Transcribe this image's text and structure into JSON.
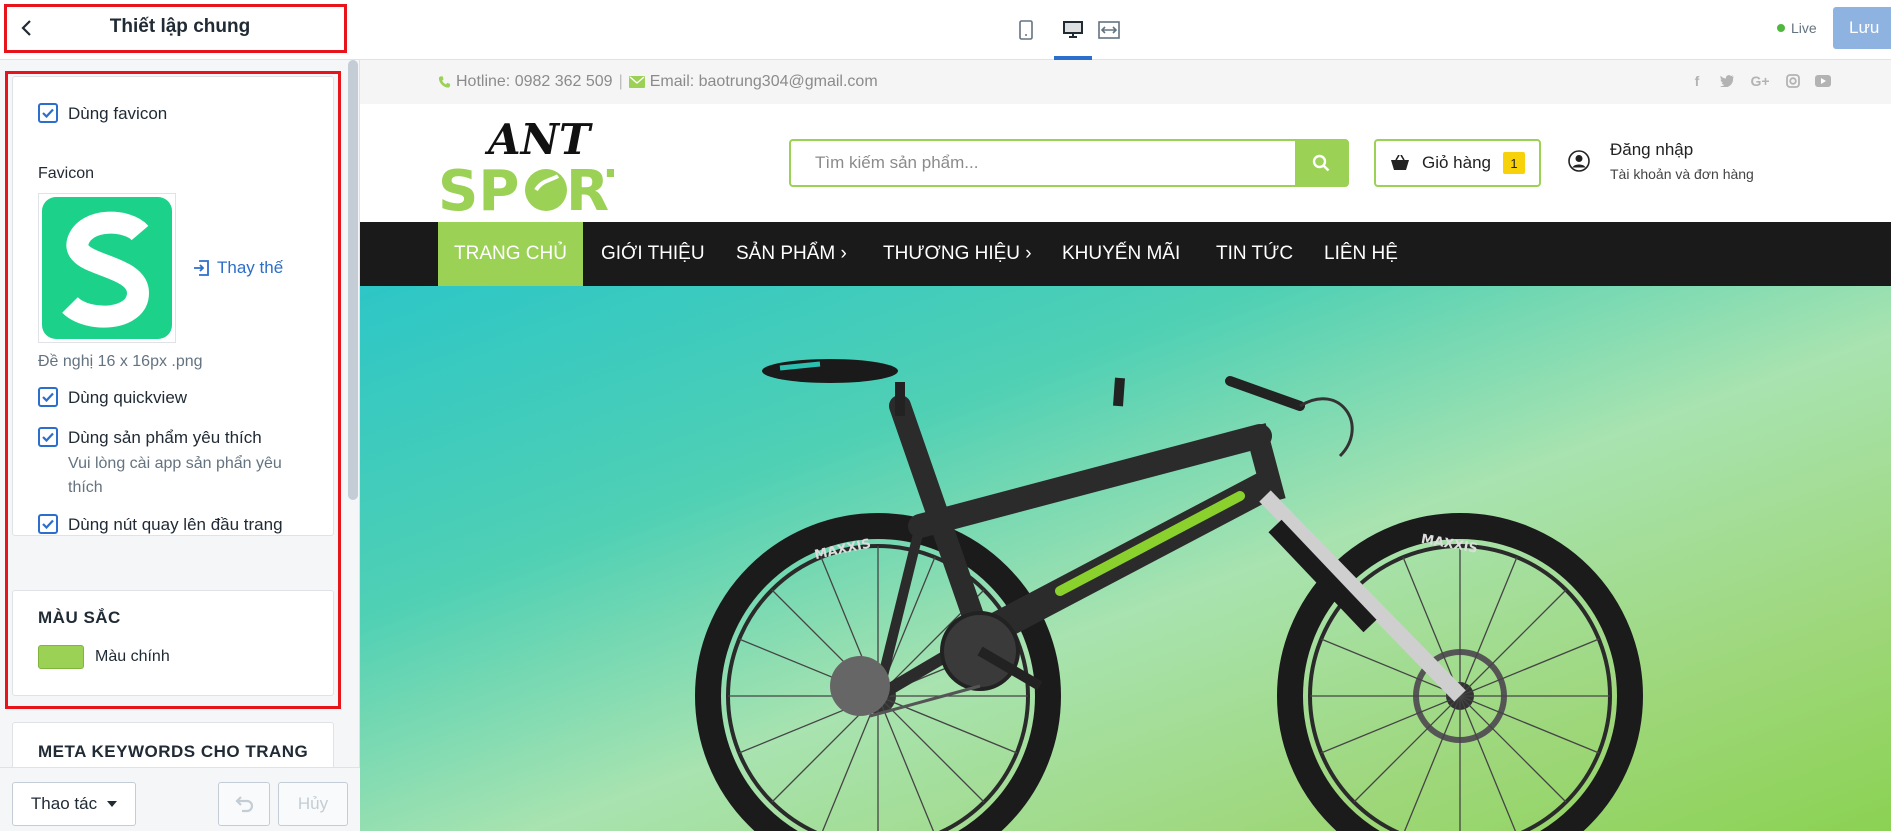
{
  "sidebar": {
    "title": "Thiết lập chung",
    "options": {
      "use_favicon": "Dùng favicon",
      "favicon_label": "Favicon",
      "replace_label": "Thay thế",
      "favicon_hint": "Đề nghị 16 x 16px .png",
      "use_quickview": "Dùng quickview",
      "use_wishlist": "Dùng sản phẩm yêu thích",
      "wishlist_note": "Vui lòng cài app sản phẩn yêu thích",
      "use_back_to_top": "Dùng nút quay lên đầu trang"
    },
    "colors": {
      "section_title": "MÀU SẮC",
      "primary_color_label": "Màu chính",
      "primary_color": "#9bd155"
    },
    "meta": {
      "section_title": "META KEYWORDS CHO TRANG CHỦ(SEO)"
    },
    "footer": {
      "actions_label": "Thao tác",
      "cancel_label": "Hủy"
    }
  },
  "topbar": {
    "live_label": "Live",
    "save_label": "Lưu"
  },
  "store": {
    "hotline": "Hotline: 0982 362 509",
    "separator": "|",
    "email": "Email: baotrung304@gmail.com",
    "search_placeholder": "Tìm kiếm sản phẩm...",
    "cart_label": "Giỏ hàng",
    "cart_count": "1",
    "login_label": "Đăng nhập",
    "account_sub": "Tài khoản và đơn hàng",
    "nav": [
      "TRANG CHỦ",
      "GIỚI THIỆU",
      "SẢN PHẨM ›",
      "THƯƠNG HIỆU ›",
      "KHUYẾN MÃI",
      "TIN TỨC",
      "LIÊN HỆ"
    ],
    "brand_color": "#9bd155"
  }
}
